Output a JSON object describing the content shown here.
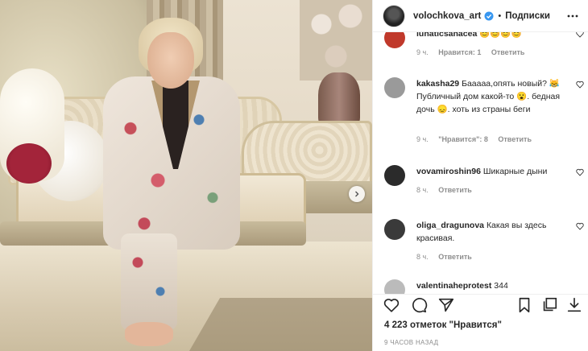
{
  "post": {
    "next_arrow": "chevron-right-icon"
  },
  "header": {
    "username": "volochkova_art",
    "separator": "•",
    "follow_label": "Подписки"
  },
  "comments": [
    {
      "user": "lunaticsanacea",
      "text": "",
      "time": "9 ч.",
      "likes": "Нравится: 1",
      "reply": "Ответить",
      "avatar_color": "#c0392b"
    },
    {
      "user": "kakasha29",
      "text": "Бааааа,опять новый? 😹 Публичный дом какой-то 😮. бедная дочь 😞. хоть из страны беги",
      "time": "9 ч.",
      "likes": "\"Нравится\": 8",
      "reply": "Ответить",
      "avatar_color": "#9a9a9a"
    },
    {
      "user": "vovamiroshin96",
      "text": "Шикарные дыни",
      "time": "8 ч.",
      "likes": "",
      "reply": "Ответить",
      "avatar_color": "#2b2b2b"
    },
    {
      "user": "oliga_dragunova",
      "text": "Какая вы здесь красивая.",
      "time": "8 ч.",
      "likes": "",
      "reply": "Ответить",
      "avatar_color": "#3a3a3a"
    },
    {
      "user": "valentinaheprotest",
      "text": "344",
      "time": "",
      "likes": "",
      "reply": "",
      "avatar_color": "#bbbbbb"
    }
  ],
  "actions": {
    "like": "heart-icon",
    "comment": "comment-icon",
    "share": "send-icon",
    "save": "bookmark-icon",
    "collection": "collection-icon",
    "download": "download-icon"
  },
  "likes_text": "4 223 отметок \"Нравится\"",
  "time_ago": "9 ЧАСОВ НАЗАД"
}
